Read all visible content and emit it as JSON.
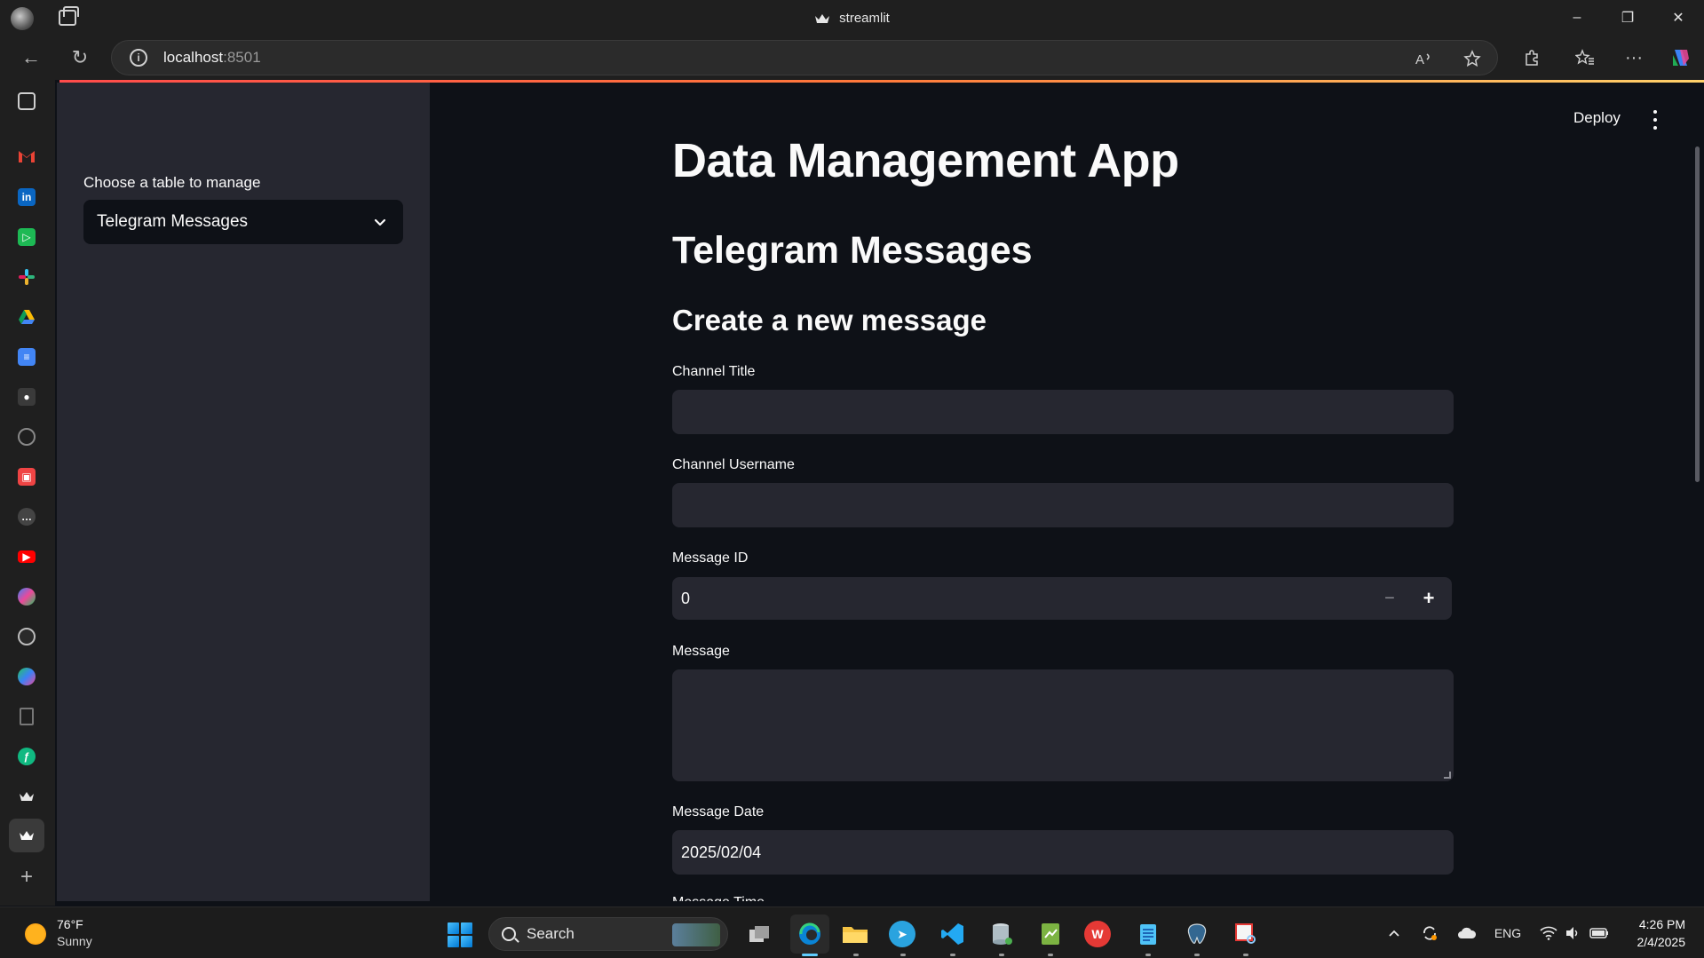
{
  "window": {
    "title": "streamlit",
    "minimize": "–",
    "restore": "❐",
    "close": "✕"
  },
  "browser": {
    "url_host": "localhost",
    "url_port": ":8501",
    "back": "←",
    "reload": "↻",
    "more": "···"
  },
  "sidebar": {
    "select_label": "Choose a table to manage",
    "selected_table": "Telegram Messages"
  },
  "header": {
    "deploy_label": "Deploy"
  },
  "main": {
    "app_title": "Data Management App",
    "table_title": "Telegram Messages",
    "section_title": "Create a new message",
    "fields": {
      "channel_title": {
        "label": "Channel Title",
        "value": ""
      },
      "channel_username": {
        "label": "Channel Username",
        "value": ""
      },
      "message_id": {
        "label": "Message ID",
        "value": "0",
        "minus": "−",
        "plus": "+"
      },
      "message": {
        "label": "Message",
        "value": ""
      },
      "message_date": {
        "label": "Message Date",
        "value": "2025/02/04"
      },
      "next_label_partial": "Message Time"
    }
  },
  "taskbar": {
    "weather_temp": "76°F",
    "weather_desc": "Sunny",
    "search_label": "Search",
    "language": "ENG",
    "time": "4:26 PM",
    "date": "2/4/2025"
  },
  "colors": {
    "app_bg": "#0e1117",
    "sidebar_bg": "#262730",
    "input_bg": "#262730",
    "browser_chrome": "#1f1f1f",
    "accent_start": "#ff4b4b",
    "accent_end": "#ffd16a"
  }
}
